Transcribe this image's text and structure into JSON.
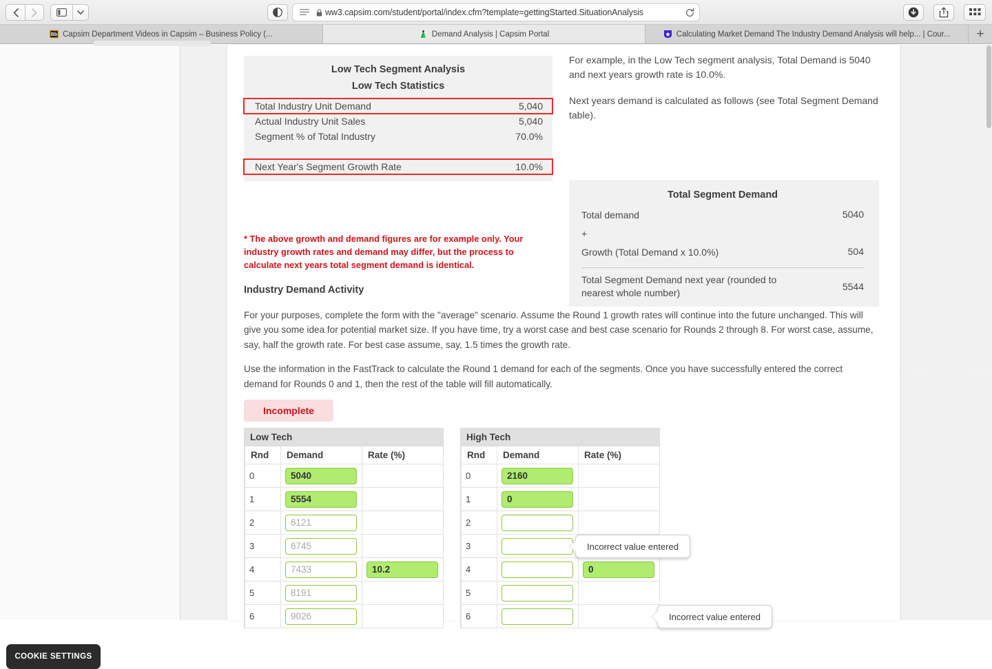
{
  "browser": {
    "back_icon": "chevron-left-icon",
    "forward_icon": "chevron-right-icon",
    "sidebar_icon": "sidebar-icon",
    "chevron_icon": "chevron-down-icon",
    "reader_icon": "reader-view-icon",
    "menu_icon": "page-menu-icon",
    "lock_icon": "lock-icon",
    "url": "ww3.capsim.com/student/portal/index.cfm?template=gettingStarted.SituationAnalysis",
    "reload_icon": "reload-icon",
    "download_icon": "download-icon",
    "share_icon": "share-icon",
    "tabs_overview_icon": "tab-overview-icon",
    "new_tab_label": "+",
    "tabs": [
      {
        "title": "Capsim Department Videos in Capsim – Business Policy (...",
        "favicon": "blackboard-icon",
        "active": false
      },
      {
        "title": "Demand Analysis | Capsim Portal",
        "favicon": "capsim-icon",
        "active": true
      },
      {
        "title": "Calculating Market Demand The Industry Demand Analysis will help... | Cour...",
        "favicon": "coursehero-icon",
        "active": false
      }
    ]
  },
  "stats_card": {
    "title": "Low Tech Segment Analysis",
    "subtitle": "Low Tech Statistics",
    "rows": [
      {
        "label": "Total Industry Unit Demand",
        "value": "5,040",
        "highlighted": true
      },
      {
        "label": "Actual Industry Unit Sales",
        "value": "5,040",
        "highlighted": false
      },
      {
        "label": "Segment % of Total Industry",
        "value": "70.0%",
        "highlighted": false
      }
    ],
    "growth_row": {
      "label": "Next Year's Segment Growth Rate",
      "value": "10.0%",
      "highlighted": true
    },
    "highlight_color": "#e8292c"
  },
  "disclaimer": "* The above growth and demand figures are for example only. Your industry growth rates and demand may differ, but the process to calculate next years total segment demand is identical.",
  "example": {
    "paragraph1": "For example, in the Low Tech segment analysis, Total Demand is 5040 and next years growth rate is 10.0%.",
    "paragraph2": "Next years demand is calculated as follows (see Total Segment Demand table)."
  },
  "total_segment_demand": {
    "title": "Total Segment Demand",
    "rows": [
      {
        "label": "Total demand",
        "value": "5040"
      },
      {
        "label": "+",
        "value": ""
      },
      {
        "label": "Growth (Total Demand x 10.0%)",
        "value": "504"
      }
    ],
    "total": {
      "label": "Total Segment Demand next year (rounded to nearest whole number)",
      "value": "5544"
    }
  },
  "activity": {
    "title": "Industry Demand Activity",
    "paragraph1": "For your purposes, complete the form with the \"average\" scenario. Assume the Round 1 growth rates will continue into the future unchanged. This will give you some idea for potential market size. If you have time, try a worst case and best case scenario for Rounds 2 through 8. For worst case, assume, say, half the growth rate. For best case assume, say, 1.5 times the growth rate.",
    "paragraph2": "Use the information in the FastTrack to calculate the Round 1 demand for each of the segments. Once you have successfully entered the correct demand for Rounds 0 and 1, then the rest of the table will fill automatically.",
    "status_badge": "Incomplete",
    "status_color": "#c6141c"
  },
  "tables": {
    "columns": [
      "Rnd",
      "Demand",
      "Rate (%)"
    ],
    "low_tech": {
      "caption": "Low Tech",
      "rows": [
        {
          "rnd": "0",
          "demand": "5040",
          "demand_filled": true,
          "rate": "",
          "rate_filled": false
        },
        {
          "rnd": "1",
          "demand": "5554",
          "demand_filled": true,
          "rate": "",
          "rate_filled": false
        },
        {
          "rnd": "2",
          "demand": "6121",
          "demand_filled": false,
          "rate": "",
          "rate_filled": false
        },
        {
          "rnd": "3",
          "demand": "6745",
          "demand_filled": false,
          "rate": "",
          "rate_filled": false
        },
        {
          "rnd": "4",
          "demand": "7433",
          "demand_filled": false,
          "rate": "10.2",
          "rate_filled": true
        },
        {
          "rnd": "5",
          "demand": "8191",
          "demand_filled": false,
          "rate": "",
          "rate_filled": false
        },
        {
          "rnd": "6",
          "demand": "9026",
          "demand_filled": false,
          "rate": "",
          "rate_filled": false
        }
      ]
    },
    "high_tech": {
      "caption": "High Tech",
      "rows": [
        {
          "rnd": "0",
          "demand": "2160",
          "demand_filled": true,
          "rate": "",
          "rate_filled": false
        },
        {
          "rnd": "1",
          "demand": "0",
          "demand_filled": true,
          "rate": "",
          "rate_filled": false
        },
        {
          "rnd": "2",
          "demand": "",
          "demand_filled": false,
          "rate": "",
          "rate_filled": false
        },
        {
          "rnd": "3",
          "demand": "",
          "demand_filled": false,
          "rate": "",
          "rate_filled": false
        },
        {
          "rnd": "4",
          "demand": "",
          "demand_filled": false,
          "rate": "0",
          "rate_filled": true
        },
        {
          "rnd": "5",
          "demand": "",
          "demand_filled": false,
          "rate": "",
          "rate_filled": false
        },
        {
          "rnd": "6",
          "demand": "",
          "demand_filled": false,
          "rate": "",
          "rate_filled": false
        }
      ]
    },
    "input_filled_bg": "#b0ec70",
    "input_border": "#8ac83c"
  },
  "tooltips": {
    "high_tech_round1": "Incorrect value entered",
    "high_tech_round4_rate": "Incorrect value entered"
  },
  "cookie_settings": "COOKIE SETTINGS"
}
